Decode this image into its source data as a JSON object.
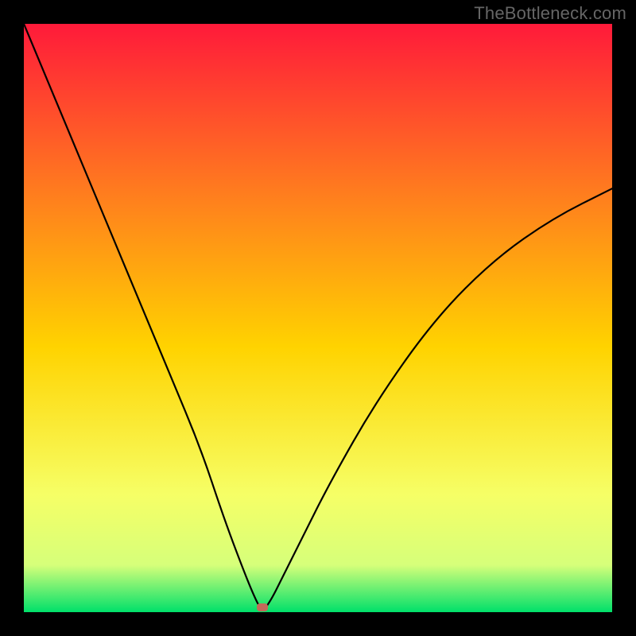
{
  "watermark": "TheBottleneck.com",
  "chart_data": {
    "type": "line",
    "title": "",
    "xlabel": "",
    "ylabel": "",
    "xlim": [
      0,
      100
    ],
    "ylim": [
      0,
      100
    ],
    "background_gradient": {
      "top": "#ff1a3a",
      "mid_upper": "#ff7a1f",
      "mid": "#ffd300",
      "mid_lower": "#f6ff66",
      "lower": "#d6ff7a",
      "bottom": "#00e06a"
    },
    "series": [
      {
        "name": "bottleneck-curve",
        "x": [
          0,
          5,
          10,
          15,
          20,
          25,
          30,
          34,
          37,
          39,
          40.5,
          42,
          44,
          47,
          52,
          60,
          70,
          80,
          90,
          100
        ],
        "y": [
          100,
          88,
          76,
          64,
          52,
          40,
          28,
          16,
          8,
          3,
          0,
          2,
          6,
          12,
          22,
          36,
          50,
          60,
          67,
          72
        ]
      }
    ],
    "marker": {
      "name": "target-point",
      "x": 40.5,
      "y": 0.8,
      "color": "#c36a5a"
    }
  }
}
